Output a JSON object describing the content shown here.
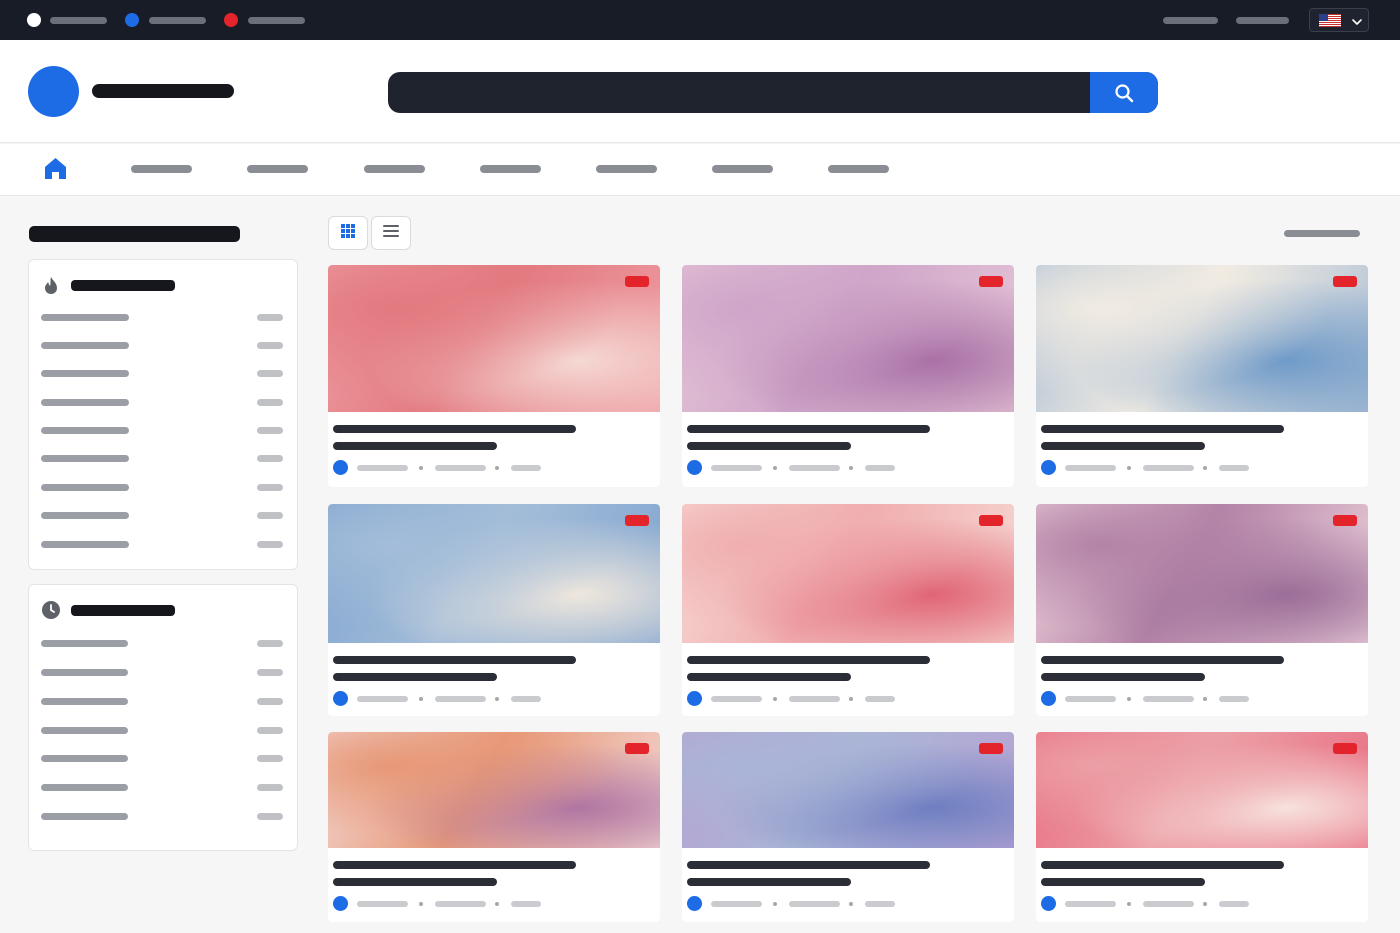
{
  "topbar": {
    "links": [
      {
        "icon": "white-dot-icon",
        "color": "#ffffff"
      },
      {
        "icon": "blue-dot-icon",
        "color": "#1e6be6"
      },
      {
        "icon": "red-dot-icon",
        "color": "#e3242b"
      }
    ],
    "right_links": 2,
    "language": {
      "flag": "us-flag-icon",
      "caret": "chevron-down-icon"
    }
  },
  "header": {
    "logo": "brand-logo",
    "search": {
      "placeholder": "",
      "button_icon": "search-icon"
    }
  },
  "nav": {
    "home_icon": "home-icon",
    "item_count": 7
  },
  "sidebar": {
    "panels": [
      {
        "icon": "flame-icon",
        "row_count": 9
      },
      {
        "icon": "clock-icon",
        "row_count": 7
      }
    ]
  },
  "toolbar": {
    "views": [
      "grid-view-icon",
      "list-view-icon"
    ],
    "active_view": "grid"
  },
  "colors": {
    "accent": "#1e6be6",
    "badge": "#e3242b",
    "topbar": "#181c27",
    "dark_text": "#15171c"
  },
  "cards": [
    {
      "thumb_colors": [
        "#e27a80",
        "#f5d9d4",
        "#ef9ea4"
      ]
    },
    {
      "thumb_colors": [
        "#cfa5c9",
        "#a971a6",
        "#e8c9d8"
      ]
    },
    {
      "thumb_colors": [
        "#f1ebe2",
        "#6f9ac8",
        "#a8bdd4"
      ]
    },
    {
      "thumb_colors": [
        "#a3bdd9",
        "#efe7dd",
        "#7fa3cf"
      ]
    },
    {
      "thumb_colors": [
        "#f0aeb0",
        "#e06575",
        "#f7ddd6"
      ]
    },
    {
      "thumb_colors": [
        "#b483a7",
        "#9b6d98",
        "#f0d6dd"
      ]
    },
    {
      "thumb_colors": [
        "#e79877",
        "#b076a4",
        "#f3d8d5"
      ]
    },
    {
      "thumb_colors": [
        "#aab5d6",
        "#6e7ec1",
        "#b7a3d3"
      ]
    },
    {
      "thumb_colors": [
        "#ec9fa6",
        "#f7e2de",
        "#e86c80"
      ]
    }
  ]
}
